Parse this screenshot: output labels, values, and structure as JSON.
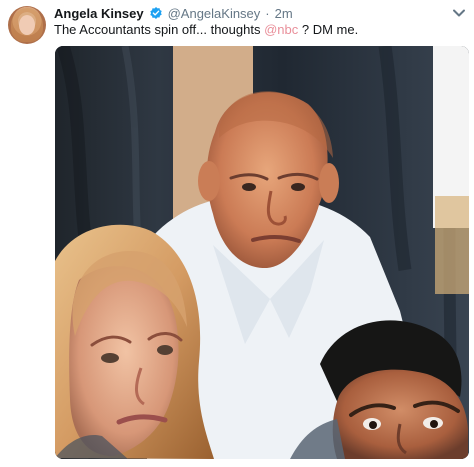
{
  "tweet": {
    "author_name": "Angela Kinsey",
    "handle": "@AngelaKinsey",
    "separator": "·",
    "time": "2m",
    "text_before": "The Accountants spin off... thoughts ",
    "mention": "@nbc",
    "text_after": " ? DM me."
  },
  "icons": {
    "verified": "verified-badge-icon",
    "more": "chevron-down-icon"
  },
  "colors": {
    "verified_blue": "#1da1f2",
    "mention_pink": "#e98f9a",
    "muted_gray": "#657786"
  }
}
